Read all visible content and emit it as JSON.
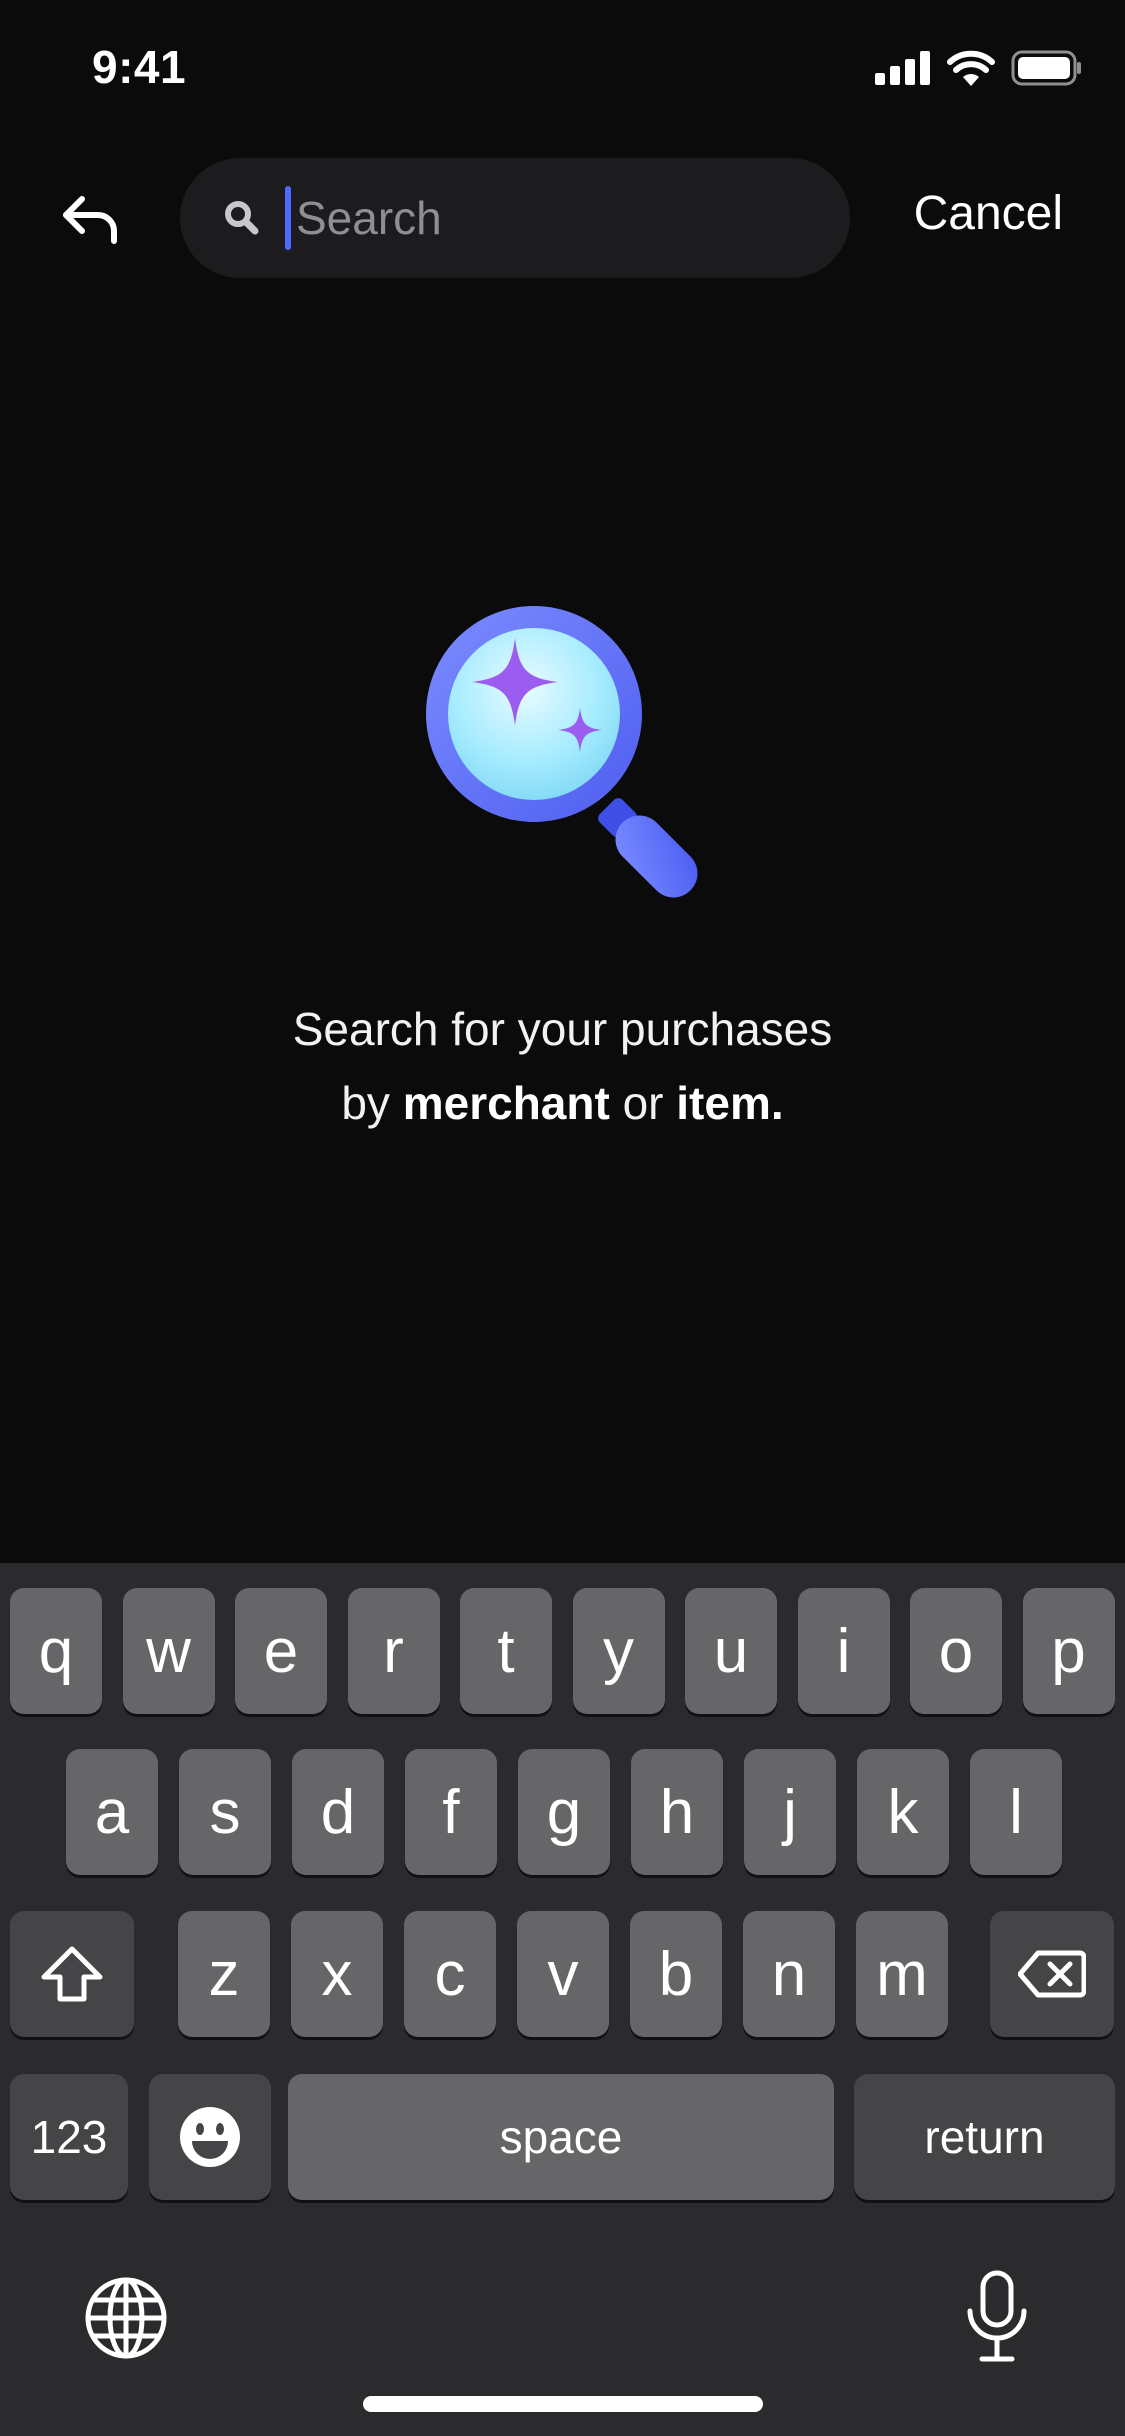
{
  "status_bar": {
    "time": "9:41",
    "icons": [
      "cellular-signal-icon",
      "wifi-icon",
      "battery-icon"
    ]
  },
  "header": {
    "back_icon": "back-arrow-icon",
    "search": {
      "placeholder": "Search",
      "value": "",
      "icon": "search-icon"
    },
    "cancel_label": "Cancel"
  },
  "empty_state": {
    "illustration": "magnifier-sparkle-icon",
    "line1": "Search for your purchases",
    "line2_prefix": "by",
    "line2_merchant": "merchant",
    "line2_or": "or",
    "line2_item": "item."
  },
  "keyboard": {
    "row1": [
      "q",
      "w",
      "e",
      "r",
      "t",
      "y",
      "u",
      "i",
      "o",
      "p"
    ],
    "row2": [
      "a",
      "s",
      "d",
      "f",
      "g",
      "h",
      "j",
      "k",
      "l"
    ],
    "row3": [
      "z",
      "x",
      "c",
      "v",
      "b",
      "n",
      "m"
    ],
    "numbers_label": "123",
    "space_label": "space",
    "return_label": "return",
    "shift_icon": "shift-icon",
    "delete_icon": "delete-icon",
    "emoji_icon": "emoji-icon",
    "globe_icon": "globe-icon",
    "mic_icon": "microphone-icon"
  },
  "colors": {
    "background": "#0b0b0c",
    "search_field": "#1c1c1e",
    "caret": "#4f6bff",
    "keyboard_bg": "#2b2b2e",
    "key": "#666669",
    "function_key": "#454548",
    "illustration_blue": "#5b6cf6",
    "illustration_sparkle": "#9b5cf0"
  }
}
